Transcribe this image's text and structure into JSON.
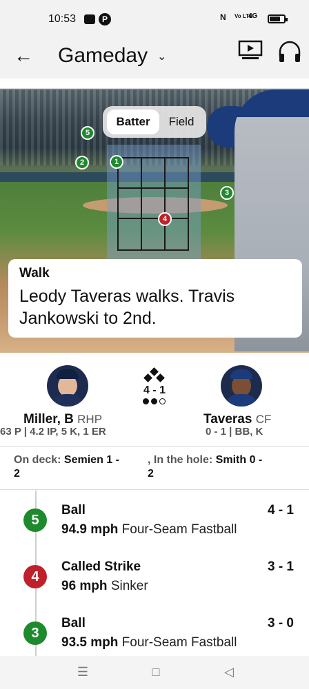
{
  "status_bar": {
    "time": "10:53",
    "network": "4G",
    "volte": "Vo LTE"
  },
  "header": {
    "title": "Gameday"
  },
  "field_view": {
    "toggle": {
      "batter_label": "Batter",
      "field_label": "Field",
      "active": "Batter"
    },
    "pitch_markers": [
      {
        "number": "1",
        "color": "#1e8a2e"
      },
      {
        "number": "2",
        "color": "#1e8a2e"
      },
      {
        "number": "3",
        "color": "#1e8a2e"
      },
      {
        "number": "4",
        "color": "#c0202a"
      },
      {
        "number": "5",
        "color": "#1e8a2e"
      }
    ]
  },
  "play": {
    "type": "Walk",
    "description": "Leody Taveras walks. Travis Jankowski to 2nd."
  },
  "matchup": {
    "pitcher": {
      "name": "Miller, B",
      "position": "RHP",
      "stats": "63 P | 4.2 IP, 5 K, 1 ER"
    },
    "batter": {
      "name": "Taveras",
      "position": "CF",
      "stats": "0 - 1 | BB, K"
    },
    "count": "4 - 1",
    "outs": 2
  },
  "on_deck": {
    "on_deck_label": "On deck:",
    "on_deck_player": "Semien 1 -",
    "on_deck_player_line2": "2",
    "in_hole_label": ", In the hole:",
    "in_hole_player": "Smith 0 -",
    "in_hole_player_line2": "2"
  },
  "pitches": [
    {
      "number": "5",
      "result": "Ball",
      "count": "4 - 1",
      "speed": "94.9 mph",
      "pitch_type": "Four-Seam Fastball",
      "color": "#1e8a2e"
    },
    {
      "number": "4",
      "result": "Called Strike",
      "count": "3 - 1",
      "speed": "96 mph",
      "pitch_type": "Sinker",
      "color": "#c0202a"
    },
    {
      "number": "3",
      "result": "Ball",
      "count": "3 - 0",
      "speed": "93.5 mph",
      "pitch_type": "Four-Seam Fastball",
      "color": "#1e8a2e"
    }
  ],
  "colors": {
    "ball": "#1e8a2e",
    "strike": "#c0202a",
    "strike_zone": "#78a0d2"
  }
}
